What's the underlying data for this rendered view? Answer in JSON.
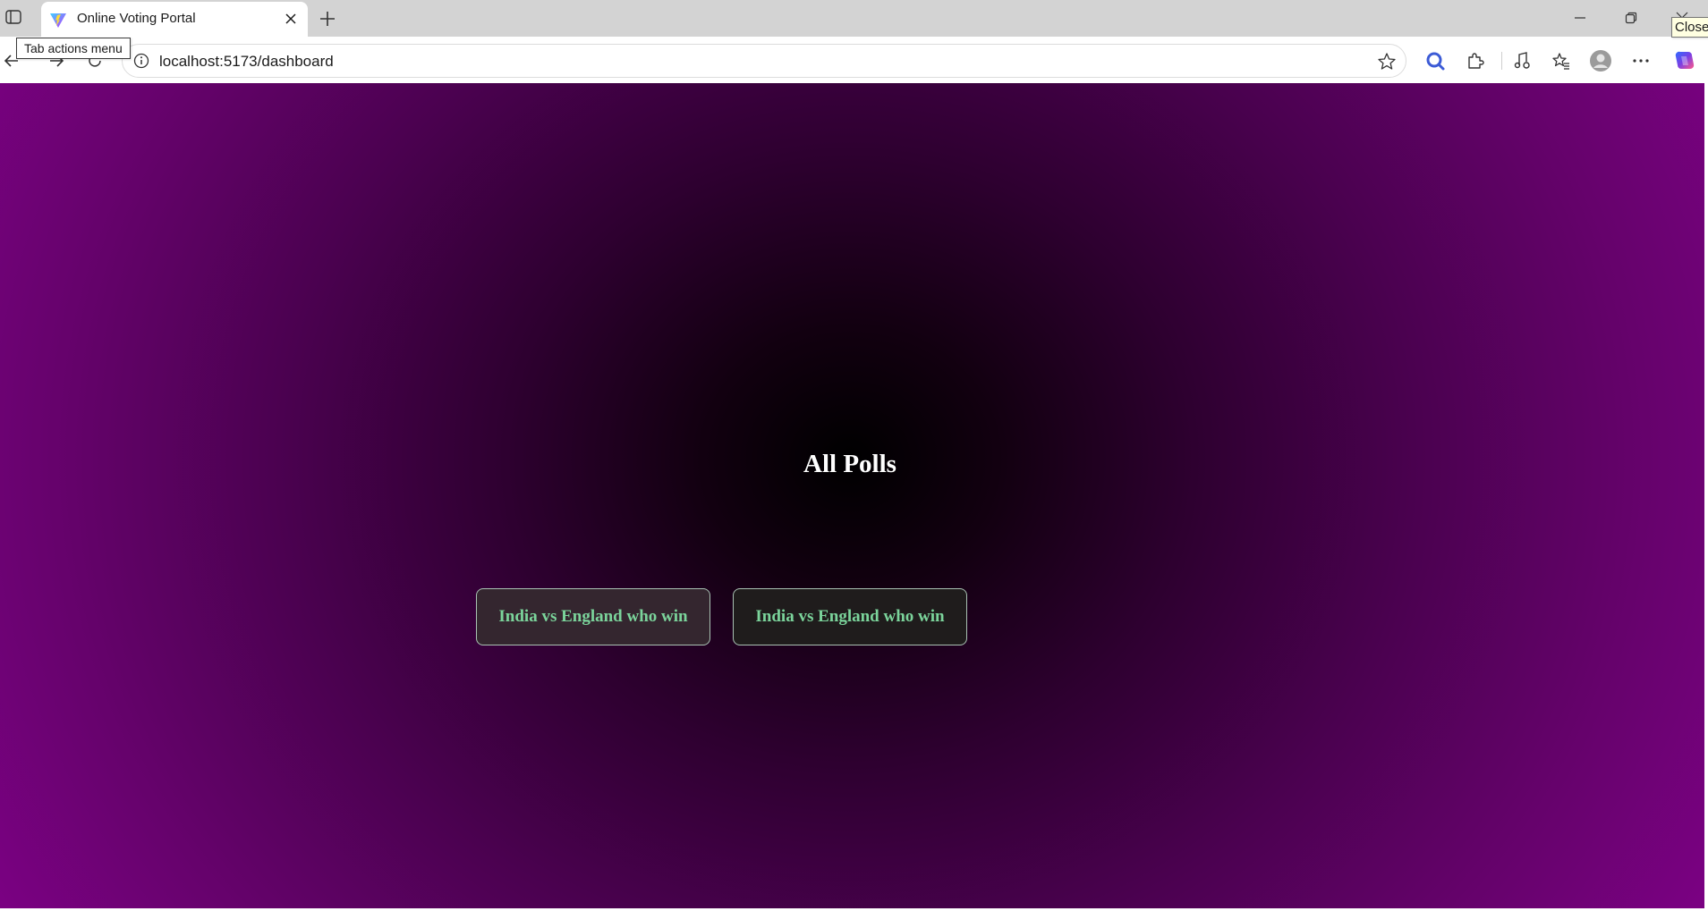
{
  "browser": {
    "tab": {
      "title": "Online Voting Portal",
      "favicon": "vite-logo-icon"
    },
    "address_bar": {
      "url": "localhost:5173/dashboard"
    },
    "tooltips": {
      "tab_actions": "Tab actions menu",
      "close": "Close"
    },
    "toolbar_icons": [
      "search-icon",
      "extensions-icon",
      "media-icon",
      "favorites-icon",
      "profile-icon",
      "more-icon",
      "copilot-icon"
    ]
  },
  "page": {
    "heading": "All Polls",
    "polls": [
      {
        "title": "India vs England who win"
      },
      {
        "title": "India vs England who win"
      }
    ]
  },
  "colors": {
    "background_center": "#000000",
    "background_edge": "#7a0182",
    "poll_text": "#7bd49b",
    "heading_text": "#ffffff"
  }
}
